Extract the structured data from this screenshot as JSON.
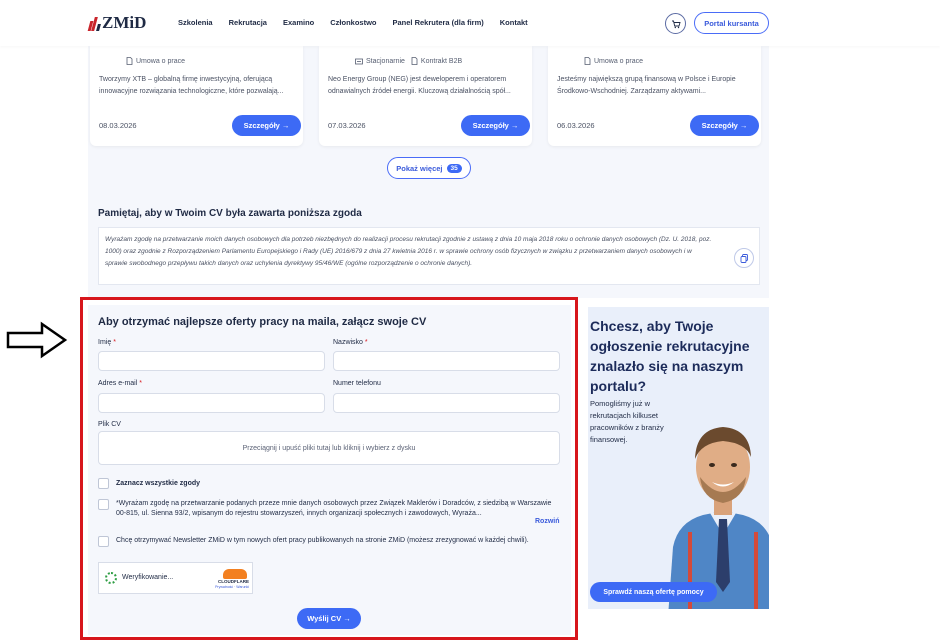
{
  "header": {
    "logo_text": "ZMiD",
    "nav": [
      "Szkolenia",
      "Rekrutacja",
      "Examino",
      "Członkostwo",
      "Panel Rekrutera (dla firm)",
      "Kontakt"
    ],
    "portal_label": "Portal kursanta"
  },
  "jobs": [
    {
      "tags": [
        "Umowa o prace"
      ],
      "desc": "Tworzymy XTB – globalną firmę inwestycyjną, oferującą innowacyjne rozwiązania technologiczne, które pozwalają...",
      "date": "08.03.2026",
      "btn": "Szczegóły →"
    },
    {
      "tags": [
        "Stacjonarnie",
        "Kontrakt B2B"
      ],
      "desc": "Neo Energy Group (NEG) jest deweloperem i operatorem odnawialnych źródeł energii. Kluczową działalnością spół...",
      "date": "07.03.2026",
      "btn": "Szczegóły →"
    },
    {
      "tags": [
        "Umowa o prace"
      ],
      "desc": "Jesteśmy największą grupą finansową w Polsce i Europie Środkowo-Wschodniej. Zarządzamy aktywami...",
      "date": "06.03.2026",
      "btn": "Szczegóły →"
    }
  ],
  "more": {
    "label": "Pokaż więcej",
    "count": "35"
  },
  "consent": {
    "title": "Pamiętaj, aby w Twoim CV była zawarta poniższa zgoda",
    "text": "Wyrażam zgodę na przetwarzanie moich danych osobowych dla potrzeb niezbędnych do realizacji procesu rekrutacji zgodnie z ustawą z dnia 10 maja 2018 roku o ochronie danych osobowych (Dz. U. 2018, poz. 1000) oraz zgodnie z Rozporządzeniem Parlamentu Europejskiego i Rady (UE) 2016/679 z dnia 27 kwietnia 2016 r. w sprawie ochrony osób fizycznych w związku z przetwarzaniem danych osobowych i w sprawie swobodnego przepływu takich danych oraz uchylenia dyrektywy 95/46/WE (ogólne rozporządzenie o ochronie danych)."
  },
  "form": {
    "title": "Aby otrzymać najlepsze oferty pracy na maila, załącz swoje CV",
    "first_name": "Imię",
    "last_name": "Nazwisko",
    "email": "Adres e-mail",
    "phone": "Numer telefonu",
    "cv_label": "Plik CV",
    "dropzone": "Przeciągnij i upuść pliki tutaj lub kliknij i wybierz z dysku",
    "select_all": "Zaznacz wszystkie zgody",
    "consent1": "*Wyrażam zgodę na przetwarzanie podanych przeze mnie danych osobowych przez Związek Maklerów i Doradców, z siedzibą w Warszawie 00-815, ul. Sienna 93/2, wpisanym do rejestru stowarzyszeń, innych organizacji społecznych i zawodowych, Wyraża...",
    "expand": "Rozwiń",
    "consent2": "Chcę otrzymywać Newsletter ZMiD w tym nowych ofert pracy publikowanych na stronie ZMiD (możesz zrezygnować w każdej chwili).",
    "captcha_status": "Weryfikowanie...",
    "captcha_brand": "CLOUDFLARE",
    "captcha_links": "Prywatność · Warunki",
    "send": "Wyślij CV →"
  },
  "promo": {
    "title": "Chcesz, aby Twoje ogłoszenie rekrutacyjne znalazło się na naszym portalu?",
    "text": "Pomogliśmy już w rekrutacjach kilkuset pracowników z branży finansowej.",
    "btn": "Sprawdź naszą ofertę pomocy"
  },
  "colors": {
    "accent": "#3d6af5",
    "highlight": "#d7161c",
    "panel": "#f5f7fc"
  }
}
